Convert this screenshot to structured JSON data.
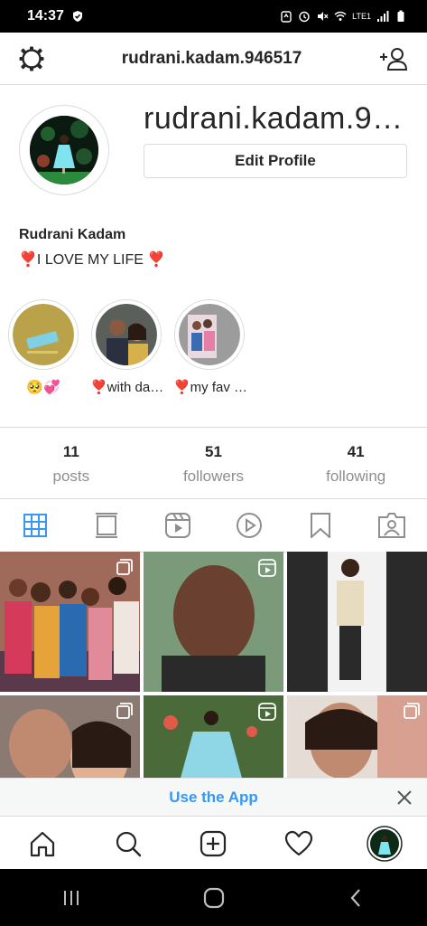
{
  "status_bar": {
    "time": "14:37",
    "network": "LTE1",
    "icons": [
      "shield-icon",
      "alarm-icon",
      "mute-icon",
      "wifi-icon",
      "signal-icon",
      "battery-icon"
    ]
  },
  "header": {
    "username": "rudrani.kadam.946517",
    "icons": [
      "settings-icon",
      "add-user-icon"
    ]
  },
  "profile": {
    "display_username": "rudrani.kadam.9…",
    "edit_button": "Edit Profile",
    "full_name": "Rudrani Kadam",
    "bio": "❣️I LOVE MY LIFE ❣️"
  },
  "highlights": [
    {
      "label": "🥺💞"
    },
    {
      "label": "❣️with da…"
    },
    {
      "label": "❣️my fav …"
    }
  ],
  "stats": [
    {
      "value": "11",
      "label": "posts"
    },
    {
      "value": "51",
      "label": "followers"
    },
    {
      "value": "41",
      "label": "following"
    }
  ],
  "tabs": [
    "grid-icon",
    "feed-icon",
    "reels-icon",
    "igtv-icon",
    "saved-icon",
    "tagged-icon"
  ],
  "banner": {
    "cta": "Use the App"
  },
  "bottom_nav": [
    "home-icon",
    "search-icon",
    "new-post-icon",
    "activity-icon",
    "profile-avatar"
  ],
  "colors": {
    "accent": "#3897f0",
    "border": "#dbdbdb",
    "muted": "#8e8e8e",
    "text": "#262626"
  }
}
